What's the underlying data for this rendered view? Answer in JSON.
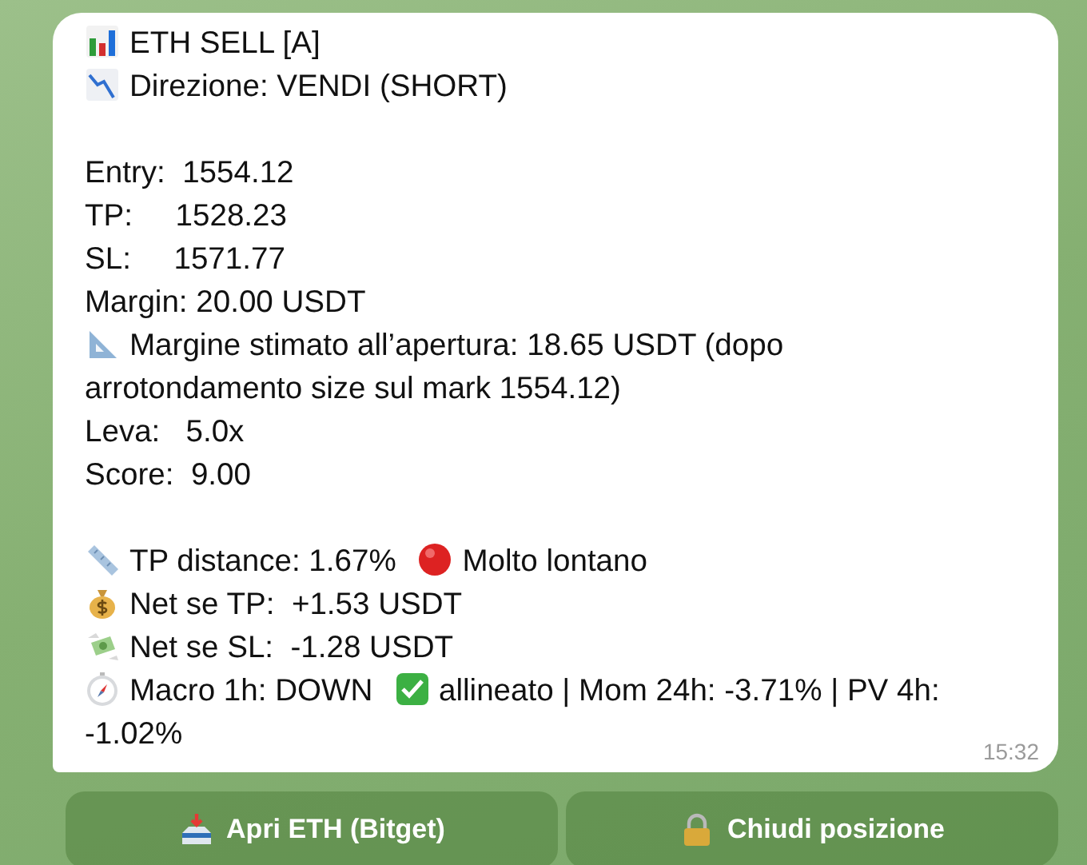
{
  "message": {
    "blocks": [
      [
        {
          "segments": [
            {
              "kind": "bars-icon"
            },
            {
              "kind": "text",
              "text": "ETH SELL [A]"
            }
          ]
        },
        {
          "segments": [
            {
              "kind": "falling-chart-icon"
            },
            {
              "kind": "text",
              "text": "Direzione: VENDI (SHORT)"
            }
          ]
        }
      ],
      [
        {
          "segments": [
            {
              "kind": "text",
              "text": "Entry:  1554.12"
            }
          ]
        },
        {
          "segments": [
            {
              "kind": "text",
              "text": "TP:     1528.23"
            }
          ]
        },
        {
          "segments": [
            {
              "kind": "text",
              "text": "SL:     1571.77"
            }
          ]
        },
        {
          "segments": [
            {
              "kind": "text",
              "text": "Margin: 20.00 USDT"
            }
          ]
        },
        {
          "segments": [
            {
              "kind": "set-square-icon"
            },
            {
              "kind": "text",
              "text": "Margine stimato all’apertura: 18.65 USDT (dopo"
            }
          ]
        },
        {
          "segments": [
            {
              "kind": "text",
              "text": "arrotondamento size sul mark 1554.12)"
            }
          ]
        },
        {
          "segments": [
            {
              "kind": "text",
              "text": "Leva:   5.0x"
            }
          ]
        },
        {
          "segments": [
            {
              "kind": "text",
              "text": "Score:  9.00"
            }
          ]
        }
      ],
      [
        {
          "segments": [
            {
              "kind": "ruler-icon"
            },
            {
              "kind": "text",
              "text": "TP distance: 1.67%"
            },
            {
              "kind": "red-circle-icon"
            },
            {
              "kind": "text",
              "text": "Molto lontano"
            }
          ]
        },
        {
          "segments": [
            {
              "kind": "money-bag-icon"
            },
            {
              "kind": "text",
              "text": "Net se TP:  +1.53 USDT"
            }
          ]
        },
        {
          "segments": [
            {
              "kind": "flying-money-icon"
            },
            {
              "kind": "text",
              "text": "Net se SL:  -1.28 USDT"
            }
          ]
        },
        {
          "segments": [
            {
              "kind": "compass-icon"
            },
            {
              "kind": "text",
              "text": "Macro 1h: DOWN"
            },
            {
              "kind": "check-icon"
            },
            {
              "kind": "text",
              "text": "allineato | Mom 24h: -3.71% | PV 4h:"
            }
          ]
        },
        {
          "segments": [
            {
              "kind": "text",
              "text": "-1.02%"
            }
          ]
        }
      ]
    ],
    "time": "15:32"
  },
  "buttons": [
    {
      "kind": "inbox-tray-icon",
      "label": "Apri ETH (Bitget)"
    },
    {
      "kind": "padlock-icon",
      "label": "Chiudi posizione"
    }
  ]
}
